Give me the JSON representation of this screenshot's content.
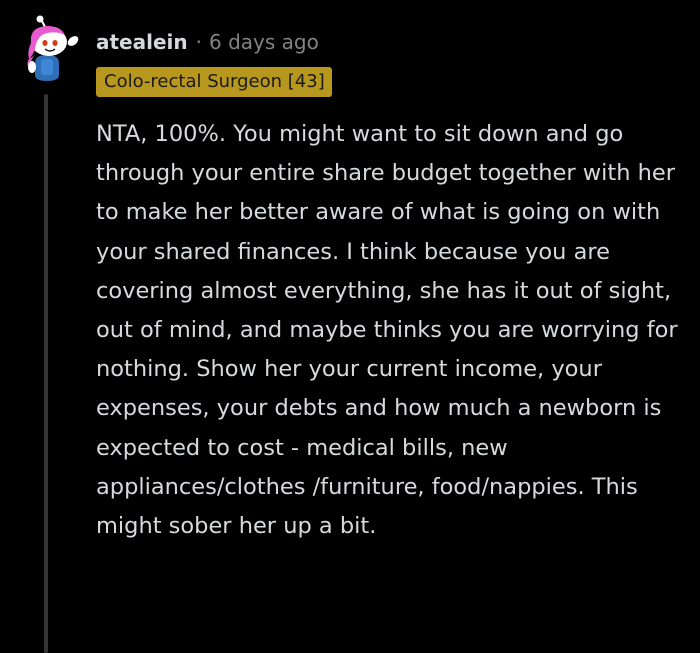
{
  "comment": {
    "username": "atealein",
    "separator": "·",
    "timestamp": "6 days ago",
    "flair": {
      "text": "Colo-rectal Surgeon [43]",
      "background": "#b8971f",
      "color": "#1a1a1b"
    },
    "avatar_icon": "snoo-avatar-icon",
    "body": "NTA, 100%. You might want to sit down and go through your entire share budget together with her to make her better aware of what is going on with your shared finances. I think because you are covering almost everything, she has it out of sight, out of mind, and maybe thinks you are worrying for nothing. Show her your current income, your expenses, your debts and how much a newborn is expected to cost - medical bills, new appliances/clothes /furniture, food/nappies. This might sober her up a bit."
  },
  "colors": {
    "background": "#000000",
    "text": "#d7dadc",
    "muted": "#818384",
    "thread_line": "#343536"
  }
}
